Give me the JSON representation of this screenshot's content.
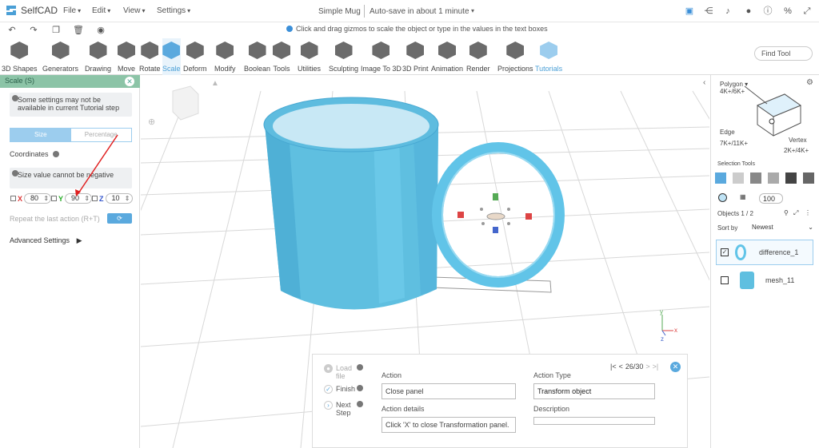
{
  "app": {
    "name": "SelfCAD",
    "doc_title": "Simple Mug",
    "autosave": "Auto-save in about 1 minute"
  },
  "menus": [
    "File",
    "Edit",
    "View",
    "Settings"
  ],
  "hint": "Click and drag gizmos to scale the object or type in the values in the text boxes",
  "toolbar": {
    "tools": [
      "3D Shapes",
      "Generators",
      "Drawing",
      "Move",
      "Rotate",
      "Scale",
      "Deform",
      "Modify",
      "Boolean",
      "Tools",
      "Utilities",
      "Sculpting",
      "Image To 3D",
      "3D Print",
      "Animation",
      "Render",
      "Projections",
      "Tutorials"
    ],
    "find_tool": "Find Tool"
  },
  "scale_panel": {
    "title": "Scale (S)",
    "warning": "Some settings may not be available in current Tutorial step",
    "tab_size": "Size",
    "tab_percentage": "Percentage",
    "coordinates": "Coordinates",
    "negative_warning": "Size value cannot be negative",
    "x_label": "X",
    "x_value": "80",
    "y_label": "Y",
    "y_value": "90",
    "z_label": "Z",
    "z_value": "10",
    "repeat": "Repeat the last action (R+T)",
    "advanced": "Advanced Settings"
  },
  "right_panel": {
    "polygon": "Polygon",
    "polygon_count": "4K+/6K+",
    "edge": "Edge",
    "edge_count": "7K+/11K+",
    "vertex": "Vertex",
    "vertex_count": "2K+/4K+",
    "selection_tools": "Selection Tools",
    "opacity": "100",
    "objects": "Objects 1 / 2",
    "sort_by": "Sort by",
    "sort_value": "Newest",
    "items": [
      {
        "name": "difference_1",
        "checked": true
      },
      {
        "name": "mesh_11",
        "checked": false
      }
    ]
  },
  "tutorial": {
    "steps": [
      "Load file",
      "Finish",
      "Next Step"
    ],
    "action_label": "Action",
    "action_value": "Close panel",
    "action_details_label": "Action details",
    "action_details_value": "Click 'X' to close Transformation panel.",
    "action_type_label": "Action Type",
    "action_type_value": "Transform object",
    "description_label": "Description",
    "description_value": "",
    "progress": "26/30"
  },
  "colors": {
    "accent": "#5aa9de",
    "mug": "#5fbfe0",
    "panel_header": "#8cc4a7"
  }
}
